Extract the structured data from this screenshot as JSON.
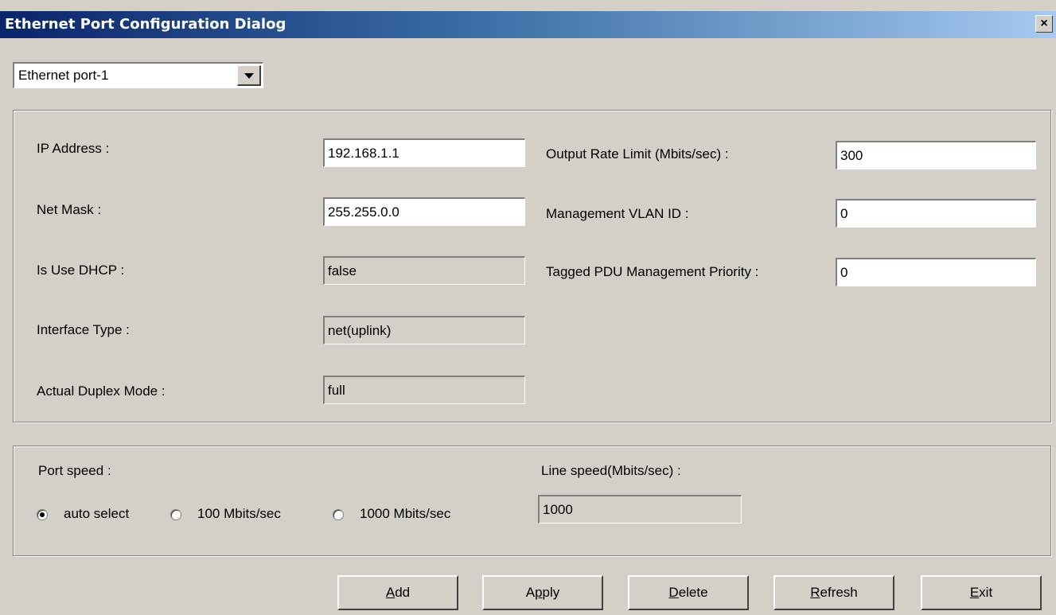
{
  "window": {
    "title": "Ethernet Port Configuration Dialog",
    "close_label": "×"
  },
  "port_select": {
    "value": "Ethernet port-1"
  },
  "config": {
    "ip_address_label": "IP Address :",
    "ip_address": "192.168.1.1",
    "net_mask_label": "Net Mask :",
    "net_mask": "255.255.0.0",
    "dhcp_label": "Is Use DHCP :",
    "dhcp": "false",
    "interface_type_label": "Interface Type :",
    "interface_type": "net(uplink)",
    "duplex_label": "Actual Duplex Mode :",
    "duplex": "full",
    "rate_limit_label": "Output Rate Limit (Mbits/sec) :",
    "rate_limit": "300",
    "vlan_label": "Management VLAN ID :",
    "vlan": "0",
    "priority_label": "Tagged PDU Management Priority :",
    "priority": "0"
  },
  "speed": {
    "port_speed_label": "Port speed :",
    "options": [
      {
        "label": "auto select",
        "selected": true
      },
      {
        "label": "100 Mbits/sec",
        "selected": false
      },
      {
        "label": "1000 Mbits/sec",
        "selected": false
      }
    ],
    "line_speed_label": "Line speed(Mbits/sec) :",
    "line_speed": "1000"
  },
  "buttons": {
    "add": {
      "mnemonic": "A",
      "rest": "dd"
    },
    "apply": {
      "pre": "A",
      "mnemonic": "p",
      "rest": "ply"
    },
    "delete": {
      "mnemonic": "D",
      "rest": "elete"
    },
    "refresh": {
      "mnemonic": "R",
      "rest": "efresh"
    },
    "exit": {
      "mnemonic": "E",
      "rest": "xit"
    }
  },
  "colors": {
    "dialog_bg": "#d4d0c8",
    "title_start": "#0a246a",
    "title_end": "#a6caf0"
  }
}
